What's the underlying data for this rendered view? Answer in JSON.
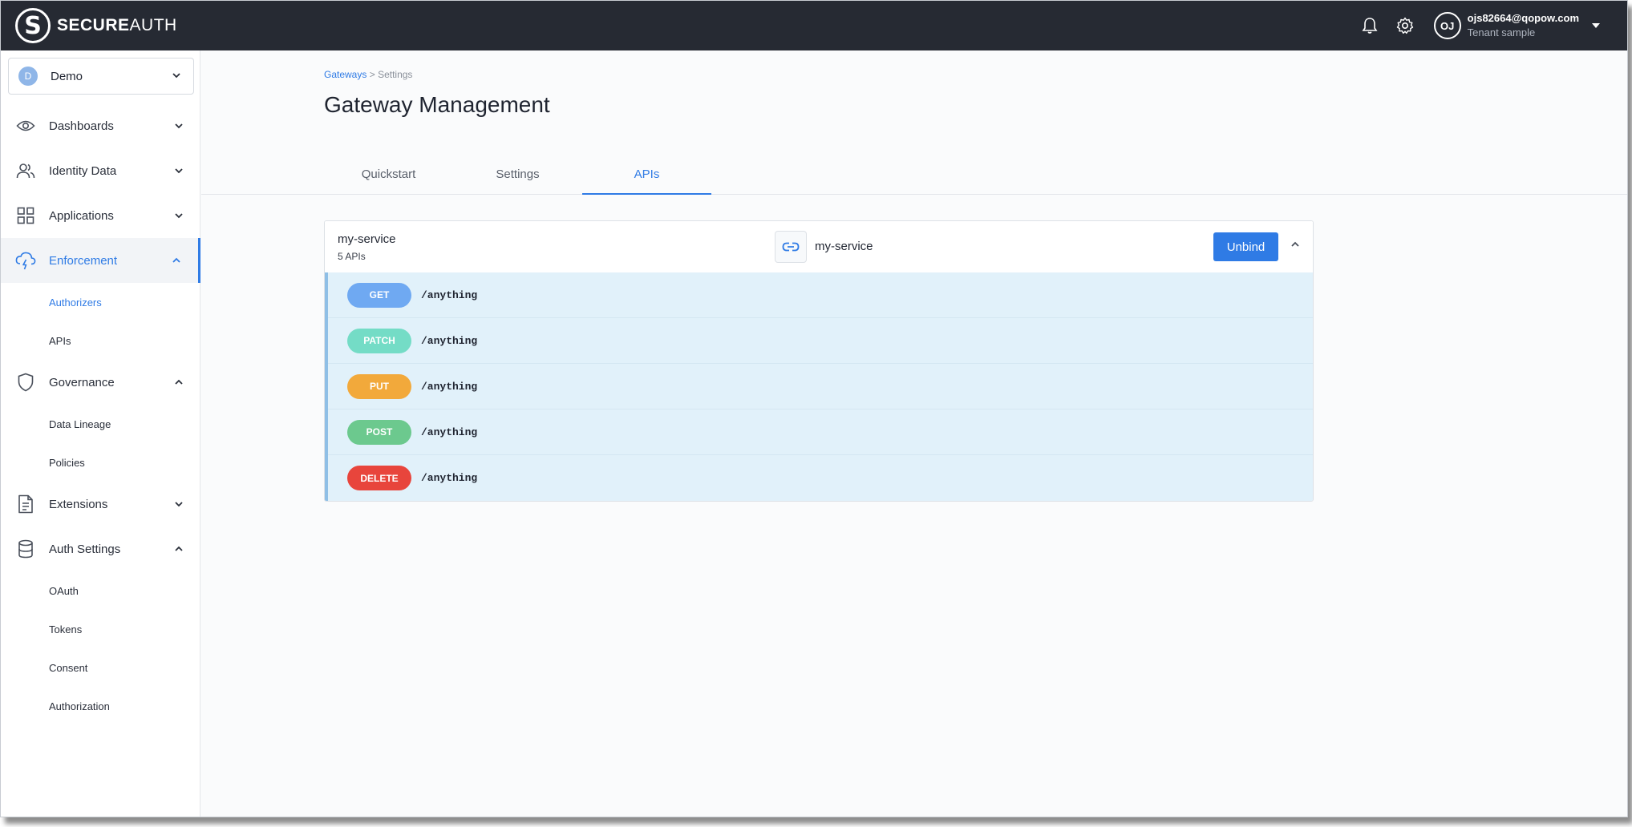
{
  "header": {
    "logo_text_bold": "SECURE",
    "logo_text_light": "AUTH",
    "logo_mark": "S",
    "notifications_icon": "bell-icon",
    "settings_icon": "gear-icon",
    "user": {
      "initials": "OJ",
      "email": "ojs82664@qopow.com",
      "tenant": "Tenant sample"
    }
  },
  "sidebar": {
    "workspace": {
      "initial": "D",
      "name": "Demo"
    },
    "items": [
      {
        "label": "Dashboards",
        "icon": "eye-icon",
        "expanded": false
      },
      {
        "label": "Identity Data",
        "icon": "users-icon",
        "expanded": false
      },
      {
        "label": "Applications",
        "icon": "grid-icon",
        "expanded": false
      },
      {
        "label": "Enforcement",
        "icon": "lightning-cloud-icon",
        "expanded": true,
        "active": true,
        "children": [
          "Authorizers",
          "APIs"
        ]
      },
      {
        "label": "Governance",
        "icon": "shield-icon",
        "expanded": true,
        "children": [
          "Data Lineage",
          "Policies"
        ]
      },
      {
        "label": "Extensions",
        "icon": "document-icon",
        "expanded": false
      },
      {
        "label": "Auth Settings",
        "icon": "database-icon",
        "expanded": true,
        "children": [
          "OAuth",
          "Tokens",
          "Consent",
          "Authorization"
        ]
      }
    ]
  },
  "main": {
    "breadcrumb": {
      "link": "Gateways",
      "separator": ">",
      "current": "Settings"
    },
    "title": "Gateway Management",
    "tabs": [
      {
        "label": "Quickstart",
        "active": false
      },
      {
        "label": "Settings",
        "active": false
      },
      {
        "label": "APIs",
        "active": true
      }
    ],
    "service": {
      "name": "my-service",
      "api_count": "5 APIs",
      "bound_name": "my-service",
      "unbind_label": "Unbind",
      "apis": [
        {
          "method": "GET",
          "path": "/anything",
          "color": "#6fa9f2"
        },
        {
          "method": "PATCH",
          "path": "/anything",
          "color": "#74dcc6"
        },
        {
          "method": "PUT",
          "path": "/anything",
          "color": "#f2a93b"
        },
        {
          "method": "POST",
          "path": "/anything",
          "color": "#6cc98e"
        },
        {
          "method": "DELETE",
          "path": "/anything",
          "color": "#e8453c"
        }
      ]
    }
  },
  "colors": {
    "accent": "#2f7be5",
    "topbar": "#262a33",
    "api_list_bg": "#e1f1fa"
  }
}
